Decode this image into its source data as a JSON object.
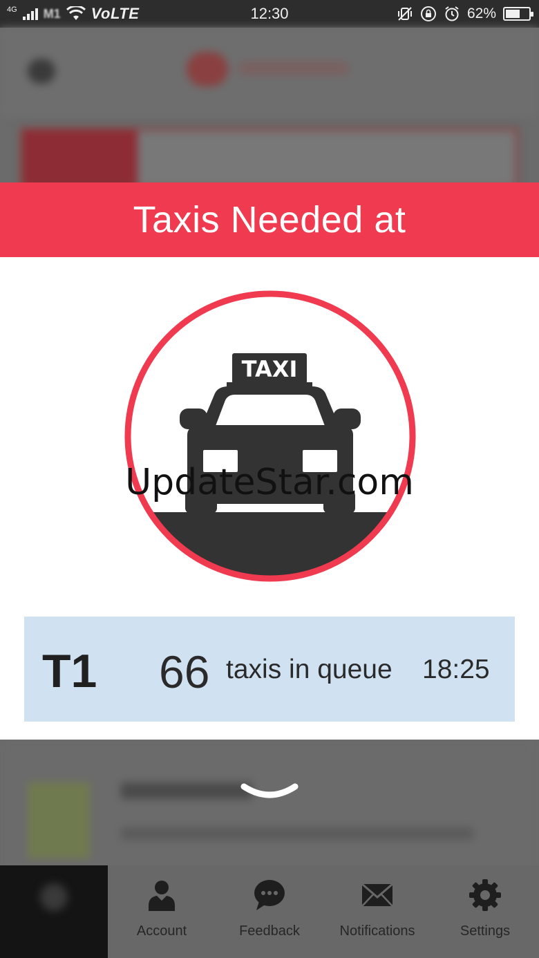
{
  "status_bar": {
    "network": "4G",
    "carrier": "M1",
    "volte": "VoLTE",
    "time": "12:30",
    "battery_percent": "62%",
    "battery_level": 0.62,
    "icons": [
      "signal-icon",
      "wifi-icon",
      "vibrate-icon",
      "rotation-lock-icon",
      "alarm-icon",
      "battery-icon"
    ]
  },
  "popup": {
    "title": "Taxis Needed at",
    "emblem_text": "TAXI",
    "queue": {
      "terminal": "T1",
      "count": "66",
      "label": "taxis in queue",
      "time": "18:25"
    }
  },
  "watermark": "UpdateStar.com",
  "bottom_nav": [
    {
      "name": "home",
      "label": "",
      "icon": "home-icon"
    },
    {
      "name": "account",
      "label": "Account",
      "icon": "person-icon"
    },
    {
      "name": "feedback",
      "label": "Feedback",
      "icon": "chat-bubble-icon"
    },
    {
      "name": "notifications",
      "label": "Notifications",
      "icon": "envelope-icon"
    },
    {
      "name": "settings",
      "label": "Settings",
      "icon": "gear-icon"
    }
  ],
  "colors": {
    "accent_red": "#ef3a4f",
    "queue_bg": "#d0e2f2",
    "dark_grey": "#333333"
  }
}
